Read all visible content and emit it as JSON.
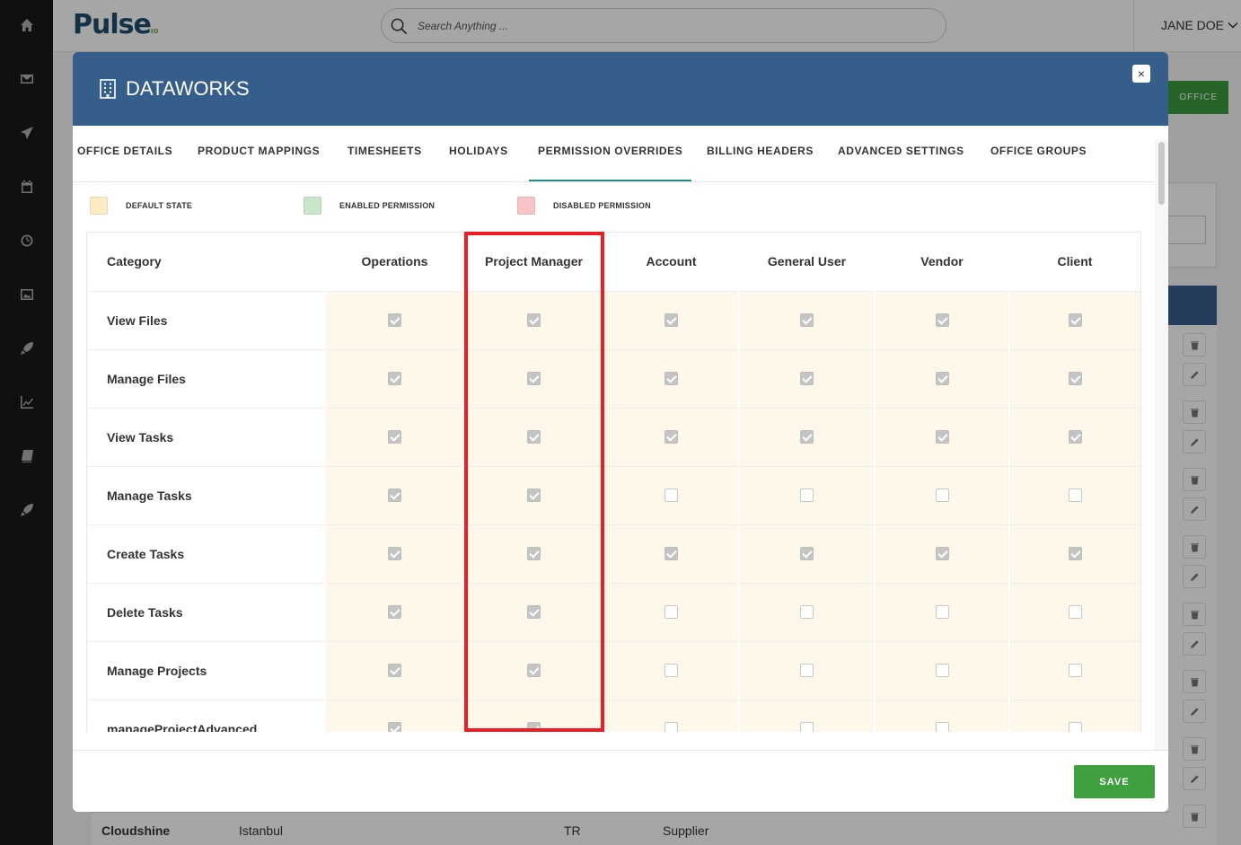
{
  "app": {
    "logo": "Pulse",
    "logo_suffix": "IO"
  },
  "search": {
    "placeholder": "Search Anything ..."
  },
  "user": {
    "name": "JANE DOE"
  },
  "sidebar": {
    "icons": [
      "home-icon",
      "mail-icon",
      "send-icon",
      "calendar-icon",
      "clock-icon",
      "image-icon",
      "rocket-icon",
      "chart-icon",
      "book-icon",
      "rocket-icon"
    ]
  },
  "background": {
    "add_button_label": "OFFICE",
    "row": {
      "name": "Cloudshine",
      "city": "Istanbul",
      "country": "TR",
      "type": "Supplier"
    }
  },
  "modal": {
    "title": "DATAWORKS",
    "close_label": "×",
    "tabs": [
      {
        "label": "OFFICE DETAILS",
        "active": false
      },
      {
        "label": "PRODUCT MAPPINGS",
        "active": false
      },
      {
        "label": "TIMESHEETS",
        "active": false
      },
      {
        "label": "HOLIDAYS",
        "active": false
      },
      {
        "label": "PERMISSION OVERRIDES",
        "active": true
      },
      {
        "label": "BILLING HEADERS",
        "active": false
      },
      {
        "label": "ADVANCED SETTINGS",
        "active": false
      },
      {
        "label": "OFFICE GROUPS",
        "active": false
      }
    ],
    "legend": [
      {
        "label": "DEFAULT STATE",
        "color": "#fdebc3"
      },
      {
        "label": "ENABLED PERMISSION",
        "color": "#c9e6c9"
      },
      {
        "label": "DISABLED PERMISSION",
        "color": "#f7c5c8"
      }
    ],
    "table": {
      "headers": [
        "Category",
        "Operations",
        "Project Manager",
        "Account",
        "General User",
        "Vendor",
        "Client"
      ],
      "rows": [
        {
          "category": "View Files",
          "values": [
            true,
            true,
            true,
            true,
            true,
            true
          ]
        },
        {
          "category": "Manage Files",
          "values": [
            true,
            true,
            true,
            true,
            true,
            true
          ]
        },
        {
          "category": "View Tasks",
          "values": [
            true,
            true,
            true,
            true,
            true,
            true
          ]
        },
        {
          "category": "Manage Tasks",
          "values": [
            true,
            true,
            false,
            false,
            false,
            false
          ]
        },
        {
          "category": "Create Tasks",
          "values": [
            true,
            true,
            true,
            true,
            true,
            true
          ]
        },
        {
          "category": "Delete Tasks",
          "values": [
            true,
            true,
            false,
            false,
            false,
            false
          ]
        },
        {
          "category": "Manage Projects",
          "values": [
            true,
            true,
            false,
            false,
            false,
            false
          ]
        },
        {
          "category": "manageProjectAdvanced",
          "values": [
            true,
            true,
            false,
            false,
            false,
            false
          ]
        }
      ]
    },
    "save_label": "SAVE"
  },
  "colors": {
    "header_blue": "#355e8a",
    "save_green": "#3ea03e",
    "highlight_red": "#ee1c24",
    "default_state_cell": "#fdf8ea",
    "active_tab_underline": "#2a8a84"
  }
}
